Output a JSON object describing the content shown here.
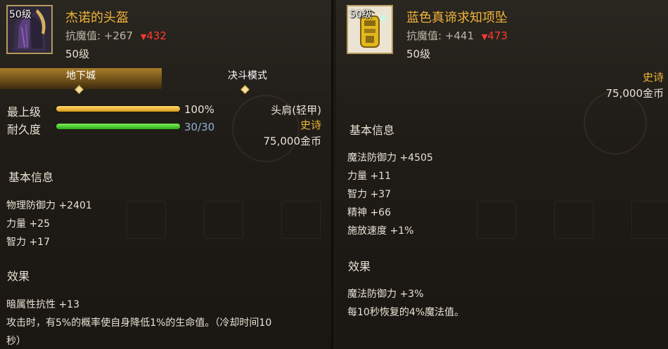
{
  "left": {
    "level_badge": "50级",
    "name": "杰诺的头盔",
    "resist_label": "抗魔值: +267",
    "resist_delta": "432",
    "level_text": "50级",
    "tabs": [
      {
        "label": "地下城",
        "active": true
      },
      {
        "label": "决斗模式",
        "active": false
      }
    ],
    "bars": [
      {
        "label": "最上级",
        "value_text": "100%",
        "fraction": 1.0,
        "color": "gold"
      },
      {
        "label": "耐久度",
        "value_text": "30/30",
        "fraction": 1.0,
        "color": "green"
      }
    ],
    "slot_type": "头肩(轻甲)",
    "rarity": "史诗",
    "price": "75,000金币",
    "basic_info_title": "基本信息",
    "attributes": [
      "物理防御力 +2401",
      "力量 +25",
      "智力 +17"
    ],
    "effect_title": "效果",
    "effects": [
      "暗属性抗性 +13",
      "攻击时，有5%的概率使自身降低1%的生命值。（冷却时间10",
      "秒）"
    ]
  },
  "right": {
    "level_badge": "50级",
    "name": "蓝色真谛求知项坠",
    "resist_label": "抗魔值: +441",
    "resist_delta": "473",
    "level_text": "50级",
    "rarity": "史诗",
    "price": "75,000金币",
    "basic_info_title": "基本信息",
    "attributes": [
      "魔法防御力 +4505",
      "力量 +11",
      "智力 +37",
      "精神 +66",
      "施放速度 +1%"
    ],
    "effect_title": "效果",
    "effects": [
      "魔法防御力 +3%",
      "每10秒恢复的4%魔法值。"
    ]
  },
  "colors": {
    "name": "#f0b43a",
    "down_arrow": "#ff3b30",
    "epic": "#f0b43a",
    "durability_value": "#8fb0d8"
  },
  "icons": {
    "left_item": "helmet-icon",
    "right_item": "pendant-icon"
  }
}
